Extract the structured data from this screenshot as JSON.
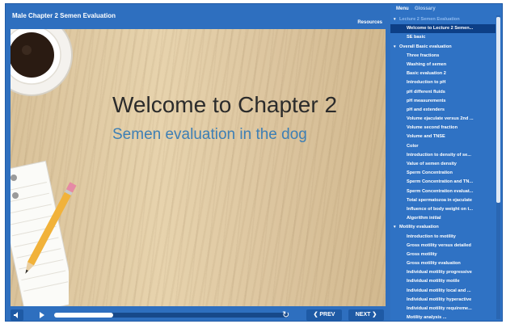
{
  "header": {
    "title": "Male Chapter 2 Semen Evaluation",
    "resources": "Resources"
  },
  "slide": {
    "title": "Welcome to Chapter 2",
    "subtitle": "Semen evaluation in the dog"
  },
  "controls": {
    "prev_label": "❮ PREV",
    "next_label": "NEXT ❯",
    "progress": 0.25
  },
  "sidebar": {
    "tabs": {
      "menu": "Menu",
      "glossary": "Glossary"
    },
    "items": [
      {
        "label": "Lecture 2 Semen Evaluation",
        "type": "section",
        "faded": true
      },
      {
        "label": "Welcome to Lecture 2 Semen...",
        "type": "item",
        "selected": true
      },
      {
        "label": "SE basic",
        "type": "item"
      },
      {
        "label": "Overall Basic evaluation",
        "type": "section"
      },
      {
        "label": "Three fractions",
        "type": "item"
      },
      {
        "label": "Washing of semen",
        "type": "item"
      },
      {
        "label": "Basic evaluation 2",
        "type": "item"
      },
      {
        "label": "Introduction to pH",
        "type": "item"
      },
      {
        "label": "pH different fluids",
        "type": "item"
      },
      {
        "label": "pH measurements",
        "type": "item"
      },
      {
        "label": "pH and extenders",
        "type": "item"
      },
      {
        "label": "Volume ejaculate versus 2nd ...",
        "type": "item"
      },
      {
        "label": "Volume second fraction",
        "type": "item"
      },
      {
        "label": "Volume and TNSE",
        "type": "item"
      },
      {
        "label": "Color",
        "type": "item"
      },
      {
        "label": "Introduction to density of se...",
        "type": "item"
      },
      {
        "label": "Value of semen density",
        "type": "item"
      },
      {
        "label": "Sperm Concentration",
        "type": "item"
      },
      {
        "label": "Sperm Concentration and TN...",
        "type": "item"
      },
      {
        "label": "Sperm Concentration evaluat...",
        "type": "item"
      },
      {
        "label": "Total spermatozoa in ejaculate",
        "type": "item"
      },
      {
        "label": "Influence of body weight on t...",
        "type": "item"
      },
      {
        "label": "Algorithm initial",
        "type": "item"
      },
      {
        "label": "Motility evaluation",
        "type": "section"
      },
      {
        "label": "Introduction to motility",
        "type": "item"
      },
      {
        "label": "Gross motility versus detailed",
        "type": "item"
      },
      {
        "label": "Gross motility",
        "type": "item"
      },
      {
        "label": "Gross motility evaluation",
        "type": "item"
      },
      {
        "label": "Individual motility progressive",
        "type": "item"
      },
      {
        "label": "Individual motility motile",
        "type": "item"
      },
      {
        "label": "Individual motility local and ...",
        "type": "item"
      },
      {
        "label": "Individual motility hyperactive",
        "type": "item"
      },
      {
        "label": "Individual motility requireme...",
        "type": "item"
      },
      {
        "label": "Motility analysis ...",
        "type": "item"
      }
    ]
  }
}
